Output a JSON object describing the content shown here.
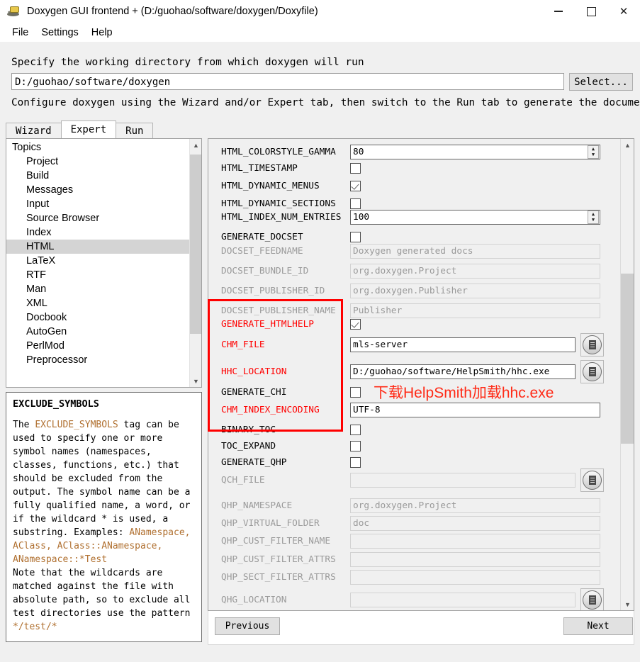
{
  "window": {
    "title": "Doxygen GUI frontend + (D:/guohao/software/doxygen/Doxyfile)",
    "icon": "doxygen-app-icon",
    "minimize": "–",
    "maximize": "□",
    "close": "✕"
  },
  "menubar": {
    "items": [
      {
        "label": "File"
      },
      {
        "label": "Settings"
      },
      {
        "label": "Help"
      }
    ]
  },
  "working_directory": {
    "label": "Specify the working directory from which doxygen will run",
    "value": "D:/guohao/software/doxygen",
    "placeholder": "",
    "select_button": "Select..."
  },
  "configure_hint": "Configure doxygen using the Wizard and/or Expert tab, then switch to the Run tab to generate the documentation",
  "tabs": [
    {
      "label": "Wizard",
      "active": false
    },
    {
      "label": "Expert",
      "active": true
    },
    {
      "label": "Run",
      "active": false
    }
  ],
  "topics": {
    "header": "Topics",
    "selected": "HTML",
    "items": [
      {
        "label": "Project"
      },
      {
        "label": "Build"
      },
      {
        "label": "Messages"
      },
      {
        "label": "Input"
      },
      {
        "label": "Source Browser"
      },
      {
        "label": "Index"
      },
      {
        "label": "HTML"
      },
      {
        "label": "LaTeX"
      },
      {
        "label": "RTF"
      },
      {
        "label": "Man"
      },
      {
        "label": "XML"
      },
      {
        "label": "Docbook"
      },
      {
        "label": "AutoGen"
      },
      {
        "label": "PerlMod"
      },
      {
        "label": "Preprocessor"
      }
    ]
  },
  "help": {
    "title": "EXCLUDE_SYMBOLS",
    "body_html": "The <span class=\"code\">EXCLUDE_SYMBOLS</span> tag can be used to specify one or more symbol names (namespaces, classes, functions, etc.) that should be excluded from the output. The symbol name can be a fully qualified name, a word, or if the wildcard * is used, a substring. Examples: <span class=\"code\">ANamespace, AClass, AClass::ANamespace, ANamespace::*Test</span><br>Note that the wildcards are matched against the file with absolute path, so to exclude all test directories use the pattern <span class=\"code\">*/test/*</span>"
  },
  "settings": {
    "rows": [
      {
        "name": "HTML_COLORSTYLE_GAMMA",
        "type": "spin",
        "value": "80",
        "state": "enabled",
        "highlight": "none"
      },
      {
        "name": "HTML_TIMESTAMP",
        "type": "checkbox",
        "value": false,
        "state": "enabled",
        "highlight": "none"
      },
      {
        "name": "HTML_DYNAMIC_MENUS",
        "type": "checkbox",
        "value": true,
        "state": "enabled",
        "highlight": "none"
      },
      {
        "name": "HTML_DYNAMIC_SECTIONS",
        "type": "checkbox",
        "value": false,
        "state": "enabled",
        "highlight": "none"
      },
      {
        "name": "HTML_INDEX_NUM_ENTRIES",
        "type": "spin",
        "value": "100",
        "state": "enabled",
        "highlight": "none"
      },
      {
        "name": "GENERATE_DOCSET",
        "type": "checkbox",
        "value": false,
        "state": "enabled",
        "highlight": "none"
      },
      {
        "name": "DOCSET_FEEDNAME",
        "type": "text",
        "value": "Doxygen generated docs",
        "state": "disabled",
        "highlight": "none"
      },
      {
        "name": "DOCSET_BUNDLE_ID",
        "type": "text",
        "value": "org.doxygen.Project",
        "state": "disabled",
        "highlight": "none"
      },
      {
        "name": "DOCSET_PUBLISHER_ID",
        "type": "text",
        "value": "org.doxygen.Publisher",
        "state": "disabled",
        "highlight": "none"
      },
      {
        "name": "DOCSET_PUBLISHER_NAME",
        "type": "text",
        "value": "Publisher",
        "state": "disabled",
        "highlight": "none"
      },
      {
        "name": "GENERATE_HTMLHELP",
        "type": "checkbox",
        "value": true,
        "state": "enabled",
        "highlight": "red"
      },
      {
        "name": "CHM_FILE",
        "type": "file",
        "value": "mls-server",
        "state": "enabled",
        "highlight": "red"
      },
      {
        "name": "HHC_LOCATION",
        "type": "file",
        "value": "D:/guohao/software/HelpSmith/hhc.exe",
        "state": "enabled",
        "highlight": "red"
      },
      {
        "name": "GENERATE_CHI",
        "type": "checkbox",
        "value": false,
        "state": "enabled",
        "highlight": "none"
      },
      {
        "name": "CHM_INDEX_ENCODING",
        "type": "text",
        "value": "UTF-8",
        "state": "enabled",
        "highlight": "red"
      },
      {
        "name": "BINARY_TOC",
        "type": "checkbox",
        "value": false,
        "state": "enabled",
        "highlight": "none"
      },
      {
        "name": "TOC_EXPAND",
        "type": "checkbox",
        "value": false,
        "state": "enabled",
        "highlight": "none"
      },
      {
        "name": "GENERATE_QHP",
        "type": "checkbox",
        "value": false,
        "state": "enabled",
        "highlight": "none"
      },
      {
        "name": "QCH_FILE",
        "type": "file",
        "value": "",
        "state": "disabled",
        "highlight": "none"
      },
      {
        "name": "QHP_NAMESPACE",
        "type": "text",
        "value": "org.doxygen.Project",
        "state": "disabled",
        "highlight": "none"
      },
      {
        "name": "QHP_VIRTUAL_FOLDER",
        "type": "text",
        "value": "doc",
        "state": "disabled",
        "highlight": "none"
      },
      {
        "name": "QHP_CUST_FILTER_NAME",
        "type": "text",
        "value": "",
        "state": "disabled",
        "highlight": "none"
      },
      {
        "name": "QHP_CUST_FILTER_ATTRS",
        "type": "text",
        "value": "",
        "state": "disabled",
        "highlight": "none"
      },
      {
        "name": "QHP_SECT_FILTER_ATTRS",
        "type": "text",
        "value": "",
        "state": "disabled",
        "highlight": "none"
      },
      {
        "name": "QHG_LOCATION",
        "type": "file",
        "value": "",
        "state": "disabled",
        "highlight": "none"
      }
    ]
  },
  "annotation": {
    "note_text": "下载HelpSmith加载hhc.exe",
    "note_color": "#ff2b17",
    "rect_color": "#ff0000"
  },
  "footer": {
    "previous_label": "Previous",
    "next_label": "Next"
  }
}
